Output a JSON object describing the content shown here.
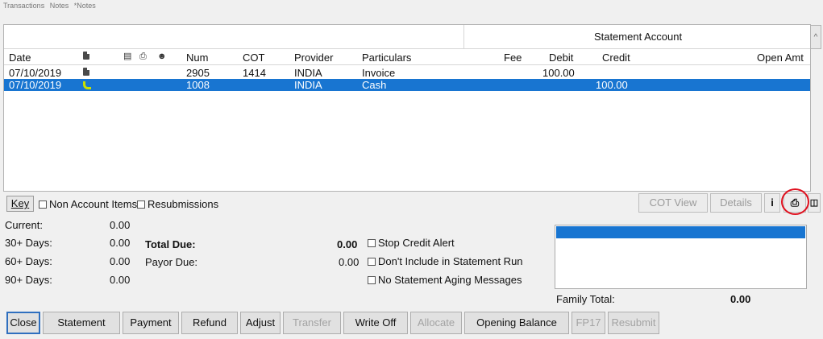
{
  "tabs": [
    "Transactions",
    "Notes",
    "*Notes"
  ],
  "grid": {
    "statement_account_label": "Statement Account",
    "columns": {
      "date": "Date",
      "num": "Num",
      "cot": "COT",
      "provider": "Provider",
      "particulars": "Particulars",
      "fee": "Fee",
      "debit": "Debit",
      "credit": "Credit",
      "open_amt": "Open Amt"
    },
    "rows": [
      {
        "date": "07/10/2019",
        "num": "2905",
        "cot": "1414",
        "provider": "INDIA",
        "particulars": "Invoice",
        "fee": "",
        "debit": "100.00",
        "credit": "",
        "open_amt": "",
        "icon": "document-icon",
        "selected": false
      },
      {
        "date": "07/10/2019",
        "num": "1008",
        "cot": "",
        "provider": "INDIA",
        "particulars": "Cash",
        "fee": "",
        "debit": "",
        "credit": "100.00",
        "open_amt": "",
        "icon": "phone-icon",
        "selected": true
      }
    ]
  },
  "toolbar": {
    "key_label": "Key",
    "non_account_items": "Non Account Items",
    "resubmissions": "Resubmissions",
    "cot_view": "COT View",
    "details": "Details",
    "info_glyph": "i"
  },
  "aging": {
    "current_label": "Current:",
    "current_value": "0.00",
    "d30_label": "30+ Days:",
    "d30_value": "0.00",
    "d60_label": "60+ Days:",
    "d60_value": "0.00",
    "d90_label": "90+ Days:",
    "d90_value": "0.00"
  },
  "totals": {
    "total_due_label": "Total Due:",
    "total_due_value": "0.00",
    "payor_due_label": "Payor Due:",
    "payor_due_value": "0.00"
  },
  "options": {
    "stop_credit_alert": "Stop Credit Alert",
    "dont_include": "Don't Include in Statement Run",
    "no_aging": "No Statement Aging Messages"
  },
  "family": {
    "label": "Family Total:",
    "value": "0.00"
  },
  "buttons": {
    "close": "Close",
    "statement": "Statement",
    "payment": "Payment",
    "refund": "Refund",
    "adjust": "Adjust",
    "transfer": "Transfer",
    "write_off": "Write Off",
    "allocate": "Allocate",
    "opening_balance": "Opening Balance",
    "fp17": "FP17",
    "resubmit": "Resubmit"
  },
  "icons": {
    "header_icons": [
      "document-icon",
      "card-icon",
      "printer-icon",
      "user-icon"
    ],
    "toolbar_icons": [
      "info-icon",
      "printer-icon",
      "delete-icon"
    ]
  },
  "colors": {
    "selection": "#1875d1",
    "highlight_circle": "#e0101e"
  }
}
